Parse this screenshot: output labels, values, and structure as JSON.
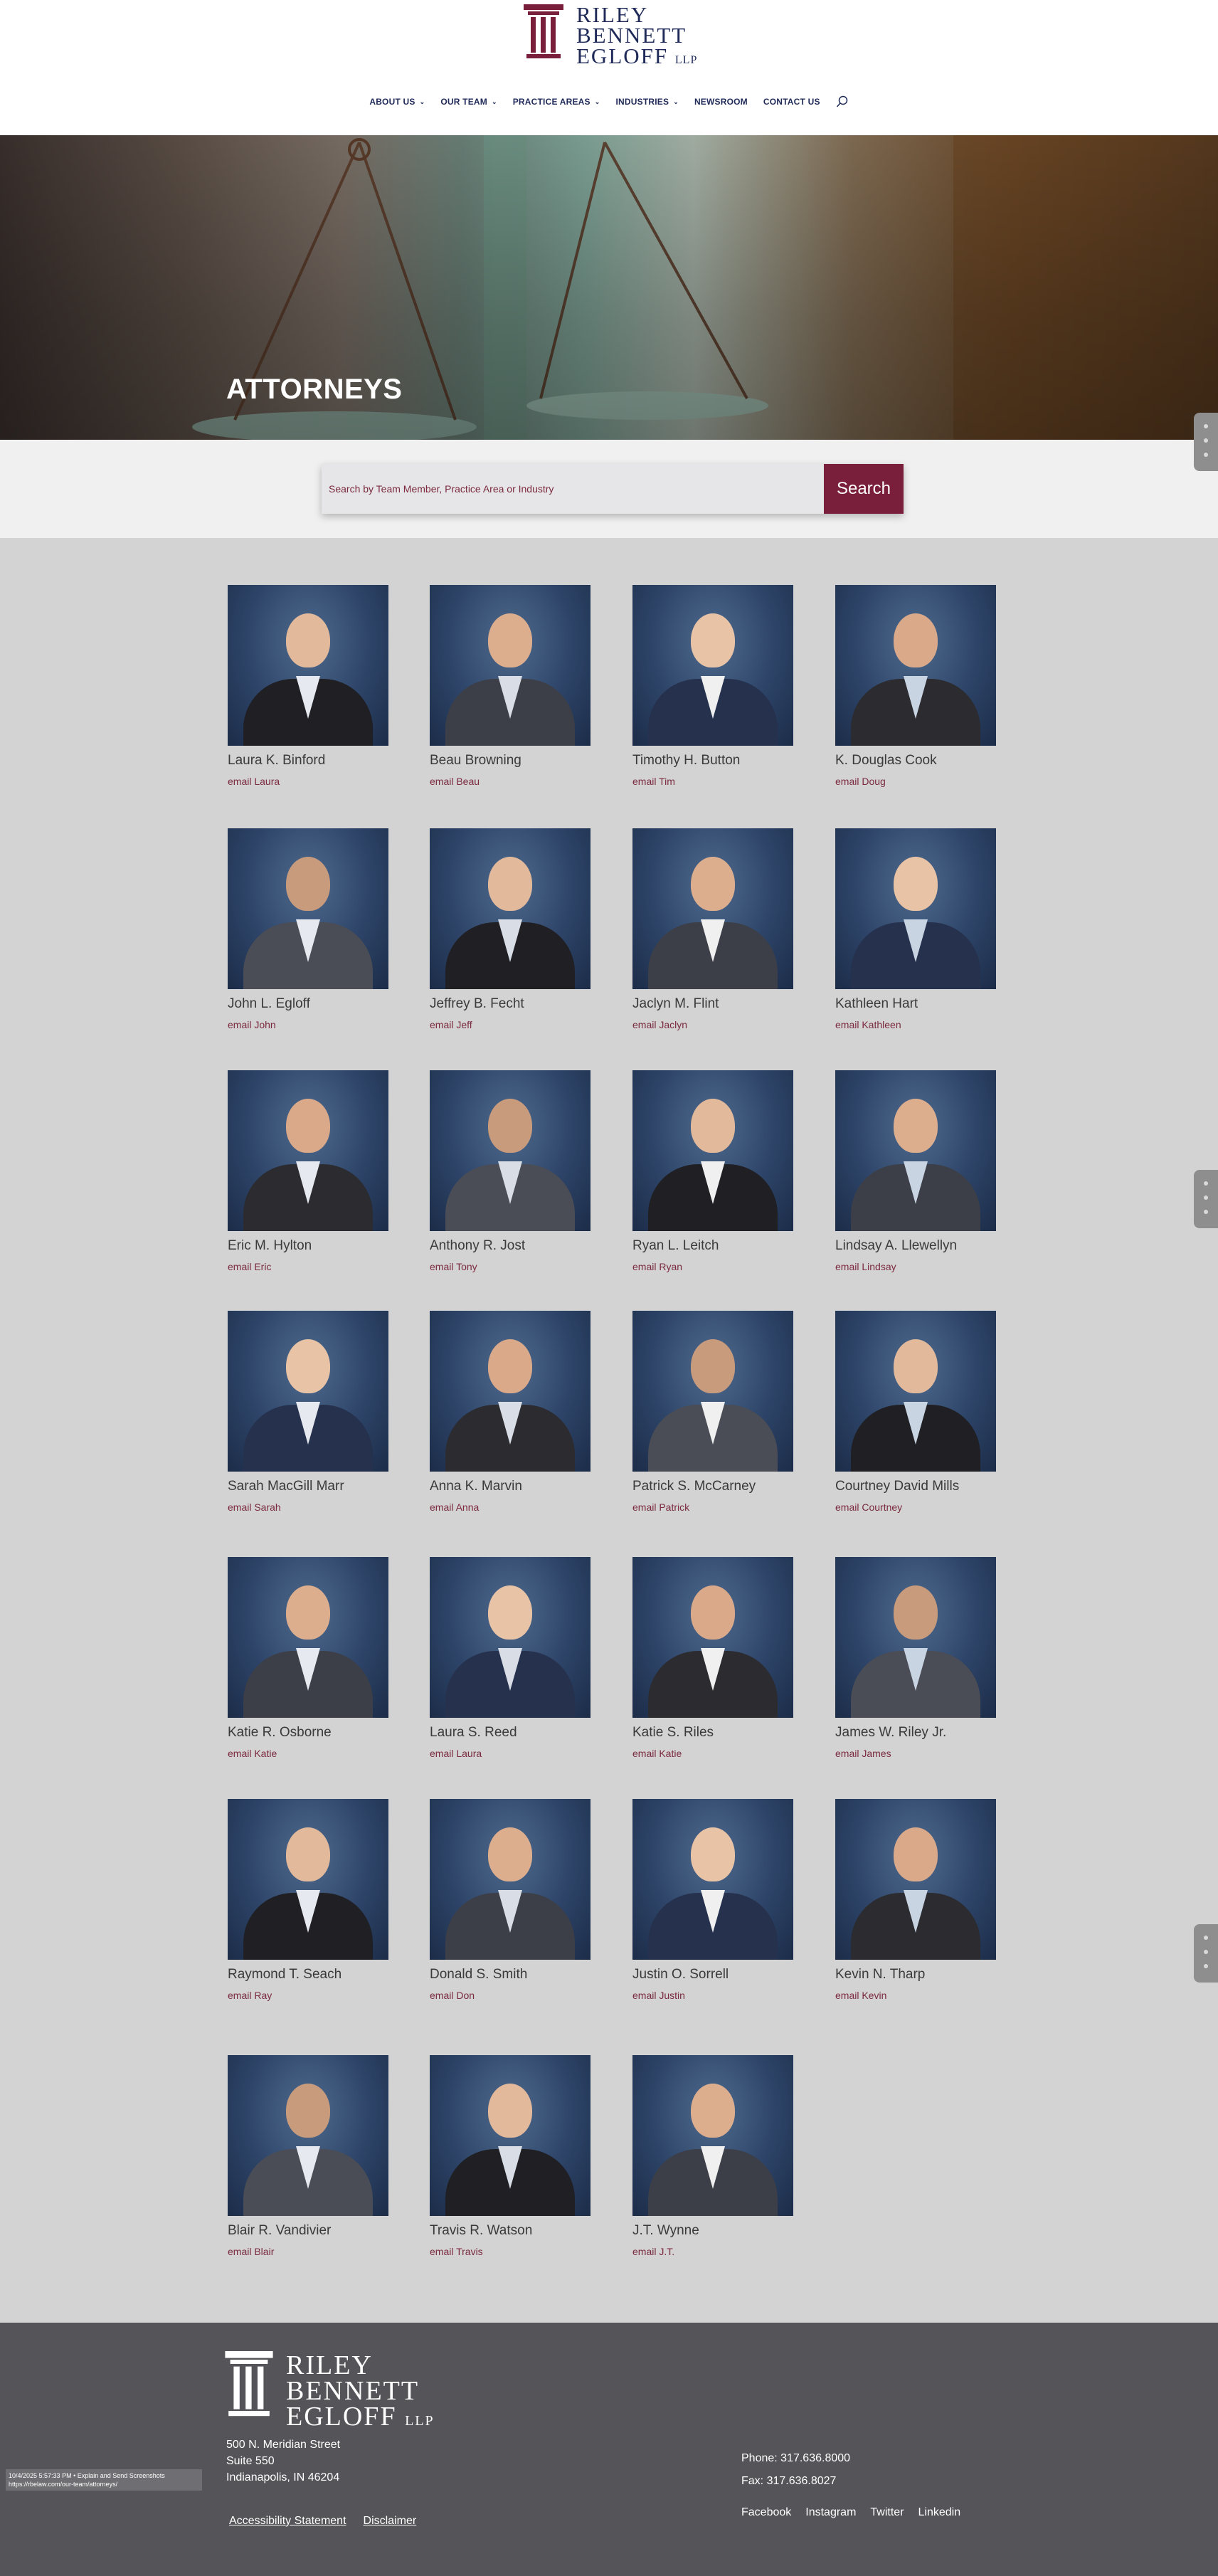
{
  "brand": {
    "line1": "RILEY",
    "line2": "BENNETT",
    "line3": "EGLOFF",
    "suffix": "LLP"
  },
  "nav": [
    {
      "label": "ABOUT US",
      "dropdown": true
    },
    {
      "label": "OUR TEAM",
      "dropdown": true
    },
    {
      "label": "PRACTICE AREAS",
      "dropdown": true
    },
    {
      "label": "INDUSTRIES",
      "dropdown": true
    },
    {
      "label": "NEWSROOM",
      "dropdown": false
    },
    {
      "label": "CONTACT US",
      "dropdown": false
    }
  ],
  "hero": {
    "title": "ATTORNEYS"
  },
  "search": {
    "placeholder": "Search by Team Member, Practice Area or Industry",
    "button_label": "Search"
  },
  "colors": {
    "accent": "#7a1f3b",
    "nav": "#1f2a58",
    "footer": "#545459"
  },
  "attorneys": [
    {
      "name": "Laura K. Binford",
      "email_label": "email Laura"
    },
    {
      "name": "Beau Browning",
      "email_label": "email Beau"
    },
    {
      "name": "Timothy H. Button",
      "email_label": "email Tim"
    },
    {
      "name": "K. Douglas Cook",
      "email_label": "email Doug"
    },
    {
      "name": "John L. Egloff",
      "email_label": "email John"
    },
    {
      "name": "Jeffrey B. Fecht",
      "email_label": "email Jeff"
    },
    {
      "name": "Jaclyn M. Flint",
      "email_label": "email Jaclyn"
    },
    {
      "name": "Kathleen Hart",
      "email_label": "email Kathleen"
    },
    {
      "name": "Eric M. Hylton",
      "email_label": "email Eric"
    },
    {
      "name": "Anthony R. Jost",
      "email_label": "email Tony"
    },
    {
      "name": "Ryan L. Leitch",
      "email_label": "email Ryan"
    },
    {
      "name": "Lindsay A. Llewellyn",
      "email_label": "email Lindsay"
    },
    {
      "name": "Sarah MacGill Marr",
      "email_label": "email Sarah"
    },
    {
      "name": "Anna K. Marvin",
      "email_label": "email Anna"
    },
    {
      "name": "Patrick S. McCarney",
      "email_label": "email Patrick"
    },
    {
      "name": "Courtney David Mills",
      "email_label": "email Courtney"
    },
    {
      "name": "Katie R. Osborne",
      "email_label": "email Katie"
    },
    {
      "name": "Laura S. Reed",
      "email_label": "email Laura"
    },
    {
      "name": "Katie S. Riles",
      "email_label": "email Katie"
    },
    {
      "name": "James W. Riley Jr.",
      "email_label": "email James"
    },
    {
      "name": "Raymond T. Seach",
      "email_label": "email Ray"
    },
    {
      "name": "Donald S. Smith",
      "email_label": "email Don"
    },
    {
      "name": "Justin O. Sorrell",
      "email_label": "email Justin"
    },
    {
      "name": "Kevin N. Tharp",
      "email_label": "email Kevin"
    },
    {
      "name": "Blair R. Vandivier",
      "email_label": "email Blair"
    },
    {
      "name": "Travis R. Watson",
      "email_label": "email Travis"
    },
    {
      "name": "J.T. Wynne",
      "email_label": "email J.T."
    }
  ],
  "footer": {
    "address_line1": "500 N. Meridian Street",
    "address_line2": "Suite 550",
    "address_line3": "Indianapolis, IN 46204",
    "phone": "Phone: 317.636.8000",
    "fax": "Fax: 317.636.8027",
    "links": [
      "Accessibility Statement",
      "Disclaimer"
    ],
    "social": [
      "Facebook",
      "Instagram",
      "Twitter",
      "Linkedin"
    ]
  },
  "status_bar": {
    "line1": "10/4/2025 5:57:33 PM • Explain and Send Screenshots",
    "line2": "https://rbelaw.com/our-team/attorneys/"
  }
}
